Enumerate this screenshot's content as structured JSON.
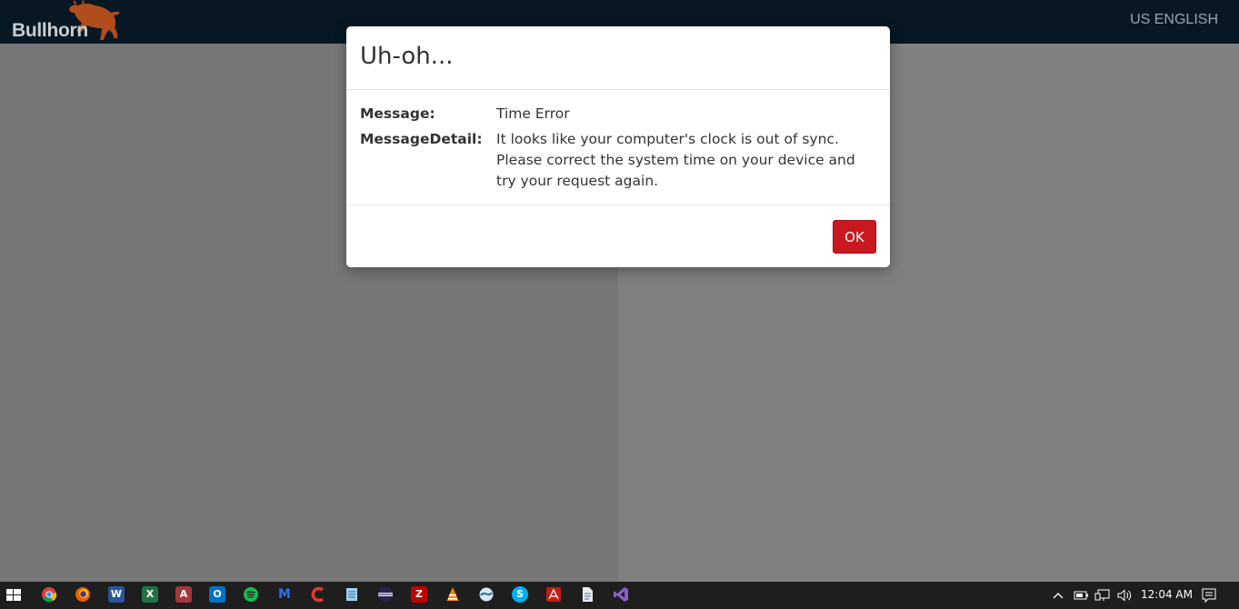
{
  "header": {
    "logo_text": "Bullhorn",
    "language": "US ENGLISH"
  },
  "dialog": {
    "title": "Uh-oh...",
    "rows": [
      {
        "label": "Message:",
        "value": "Time Error"
      },
      {
        "label": "MessageDetail:",
        "value": "It looks like your computer's clock is out of sync. Please correct the system time on your device and try your request again."
      }
    ],
    "ok_label": "OK"
  },
  "colors": {
    "topbar": "#071824",
    "ok_button": "#c9181e",
    "logo_bull": "#b14d1c",
    "taskbar": "#1e1e1e"
  },
  "taskbar": {
    "icons": [
      "windows-start-icon",
      "chrome-icon",
      "firefox-icon",
      "word-icon",
      "excel-icon",
      "access-icon",
      "outlook-icon",
      "spotify-icon",
      "malwarebytes-icon",
      "ccleaner-icon",
      "notepad-icon",
      "eclipse-icon",
      "filezilla-icon",
      "vlc-icon",
      "browser-icon",
      "skype-icon",
      "acrobat-icon",
      "document-icon",
      "visual-studio-icon"
    ],
    "glyphs": {
      "word": "W",
      "excel": "X",
      "access": "A",
      "outlook": "O",
      "malwarebytes": "M",
      "filezilla": "Z",
      "skype": "S"
    },
    "clock": "12:04 AM"
  }
}
